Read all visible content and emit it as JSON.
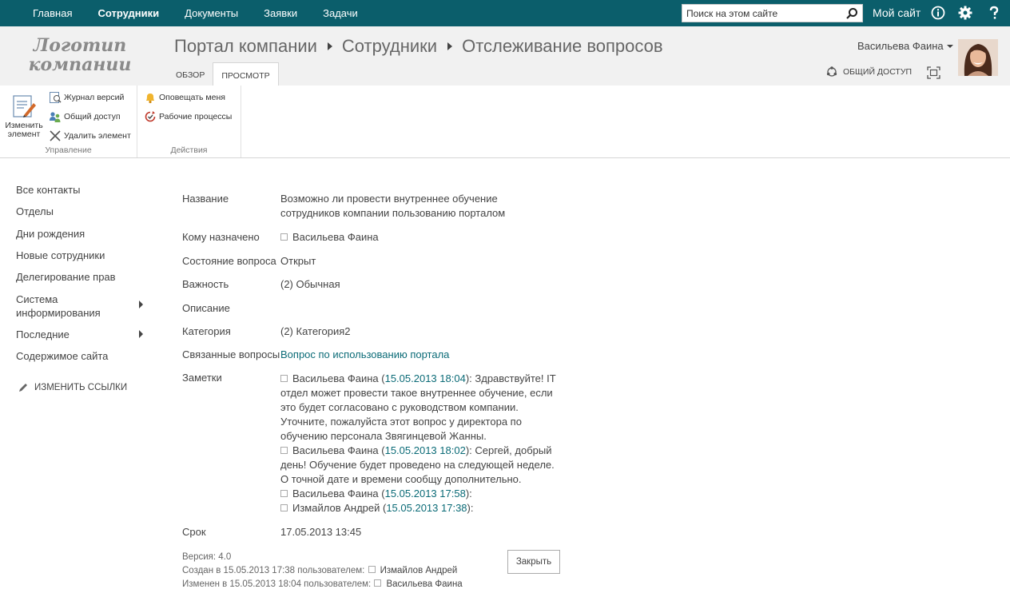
{
  "suitebar": {
    "nav": [
      "Главная",
      "Сотрудники",
      "Документы",
      "Заявки",
      "Задачи"
    ],
    "search_placeholder": "Поиск на этом сайте",
    "mysite": "Мой сайт"
  },
  "header": {
    "logo_line1": "Логотип",
    "logo_line2": "компании",
    "breadcrumb": [
      "Портал компании",
      "Сотрудники",
      "Отслеживание вопросов"
    ],
    "tabs": [
      "ОБЗОР",
      "ПРОСМОТР"
    ],
    "user": "Васильева Фаина",
    "share": "ОБЩИЙ ДОСТУП"
  },
  "ribbon": {
    "edit_item": [
      "Изменить",
      "элемент"
    ],
    "version_history": "Журнал версий",
    "shared_with": "Общий доступ",
    "delete_item": "Удалить элемент",
    "group_manage": "Управление",
    "alert_me": "Оповещать меня",
    "workflows": "Рабочие процессы",
    "group_actions": "Действия"
  },
  "leftnav": {
    "items": [
      "Все контакты",
      "Отделы",
      "Дни рождения",
      "Новые сотрудники",
      "Делегирование прав",
      "Система информирования",
      "Последние",
      "Содержимое сайта"
    ],
    "edit_links": "ИЗМЕНИТЬ ССЫЛКИ"
  },
  "form": {
    "labels": {
      "title": "Название",
      "assigned": "Кому назначено",
      "status": "Состояние вопроса",
      "priority": "Важность",
      "description": "Описание",
      "category": "Категория",
      "related": "Связанные вопросы",
      "notes": "Заметки",
      "due": "Срок"
    },
    "values": {
      "title": "Возможно ли провести внутреннее обучение сотрудников компании пользованию порталом",
      "assigned": "Васильева Фаина",
      "status": "Открыт",
      "priority": "(2) Обычная",
      "category": "(2) Категория2",
      "related": "Вопрос по использованию портала",
      "due": "17.05.2013 13:45"
    },
    "notes": [
      {
        "author": "Васильева Фаина",
        "date": "15.05.2013 18:04",
        "text": "Здравствуйте! IT отдел может провести такое внутреннее обучение, если это будет согласовано с руководством компании. Уточните, пожалуйста этот вопрос у директора по обучению персонала Звягинцевой Жанны."
      },
      {
        "author": "Васильева Фаина",
        "date": "15.05.2013 18:02",
        "text": "Сергей, добрый день! Обучение будет проведено на следующей неделе. О точной дате и времени сообщу дополнительно."
      },
      {
        "author": "Васильева Фаина",
        "date": "15.05.2013 17:58",
        "text": ""
      },
      {
        "author": "Измайлов Андрей",
        "date": "15.05.2013 17:38",
        "text": ""
      }
    ],
    "meta": {
      "version": "Версия: 4.0",
      "created": "Создан в 15.05.2013 17:38  пользователем:",
      "created_by": "Измайлов Андрей",
      "modified": "Изменен в 15.05.2013 18:04  пользователем:",
      "modified_by": "Васильева Фаина"
    },
    "close": "Закрыть"
  }
}
